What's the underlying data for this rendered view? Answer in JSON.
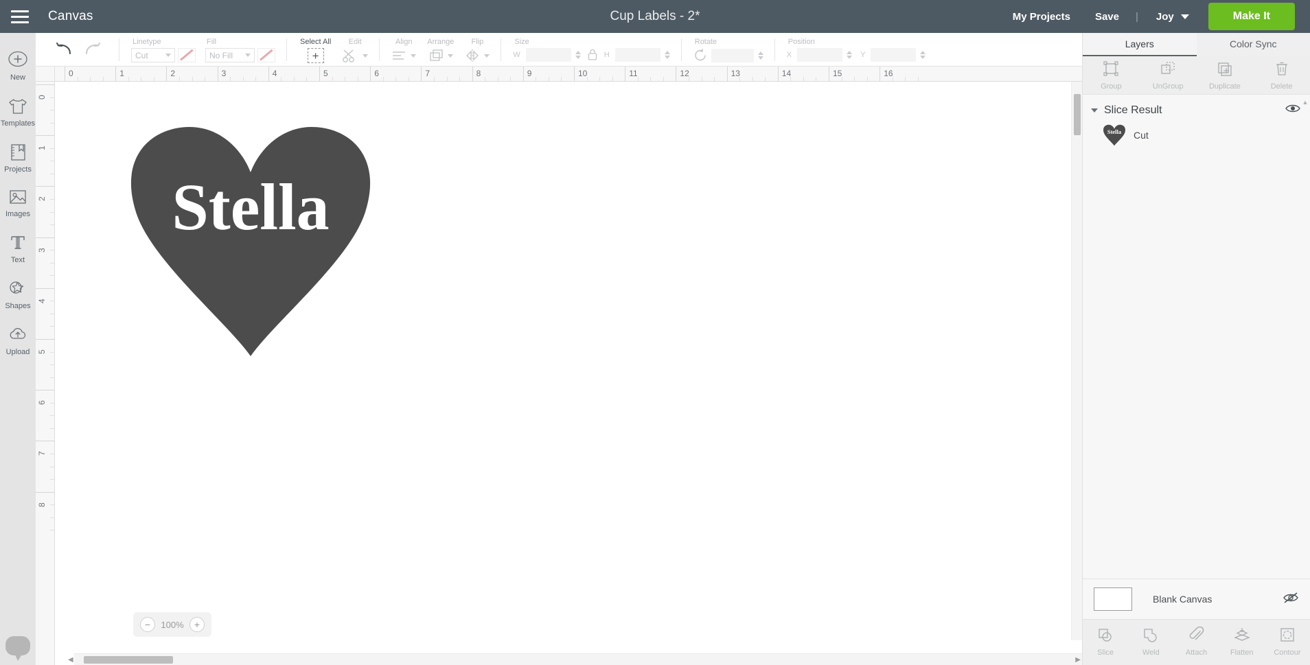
{
  "topbar": {
    "menu_icon": "hamburger-menu-icon",
    "canvas_label": "Canvas",
    "document_title": "Cup Labels - 2*",
    "my_projects": "My Projects",
    "save": "Save",
    "separator": "|",
    "machine": "Joy",
    "make_it": "Make It",
    "make_it_color": "#6cbd20",
    "background_color": "#4e5a63"
  },
  "left_rail": {
    "items": [
      {
        "label": "New",
        "icon": "plus-circle-icon"
      },
      {
        "label": "Templates",
        "icon": "tshirt-icon"
      },
      {
        "label": "Projects",
        "icon": "book-bookmark-icon"
      },
      {
        "label": "Images",
        "icon": "image-icon"
      },
      {
        "label": "Text",
        "icon": "text-t-icon"
      },
      {
        "label": "Shapes",
        "icon": "shapes-icon"
      },
      {
        "label": "Upload",
        "icon": "cloud-upload-icon"
      }
    ],
    "chat_icon": "chat-bubble-icon"
  },
  "toolbar": {
    "undo_icon": "undo-arrow-icon",
    "redo_icon": "redo-arrow-icon",
    "linetype": {
      "label": "Linetype",
      "value": "Cut",
      "swatch_icon": "line-swatch-icon"
    },
    "fill": {
      "label": "Fill",
      "value": "No Fill",
      "swatch_icon": "fill-swatch-icon"
    },
    "select_all": {
      "label": "Select All",
      "icon": "select-all-icon"
    },
    "edit": {
      "label": "Edit",
      "icon": "edit-scissors-icon"
    },
    "align": {
      "label": "Align",
      "icon": "align-icon"
    },
    "arrange": {
      "label": "Arrange",
      "icon": "arrange-icon"
    },
    "flip": {
      "label": "Flip",
      "icon": "flip-icon"
    },
    "size": {
      "label": "Size",
      "w_label": "W",
      "h_label": "H",
      "w_value": "",
      "h_value": "",
      "lock_icon": "lock-icon"
    },
    "rotate": {
      "label": "Rotate",
      "value": "",
      "icon": "rotate-icon"
    },
    "position": {
      "label": "Position",
      "x_label": "X",
      "y_label": "Y",
      "x_value": "",
      "y_value": ""
    }
  },
  "rulers": {
    "horizontal_ticks": [
      "0",
      "1",
      "2",
      "3",
      "4",
      "5",
      "6",
      "7",
      "8",
      "9",
      "10",
      "11",
      "12",
      "13",
      "14",
      "15",
      "16"
    ],
    "vertical_ticks": [
      "0",
      "1",
      "2",
      "3",
      "4",
      "5",
      "6",
      "7",
      "8"
    ],
    "unit": "in"
  },
  "canvas": {
    "zoom_level": "100%",
    "zoom_out_icon": "minus-circle-icon",
    "zoom_in_icon": "plus-circle-icon",
    "artwork": {
      "shape": "heart",
      "shape_color": "#4c4c4c",
      "text": "Stella",
      "text_color": "#ffffff"
    }
  },
  "right_panel": {
    "tabs": [
      {
        "label": "Layers",
        "active": true
      },
      {
        "label": "Color Sync",
        "active": false
      }
    ],
    "top_ops": [
      {
        "label": "Group",
        "icon": "group-icon"
      },
      {
        "label": "UnGroup",
        "icon": "ungroup-icon"
      },
      {
        "label": "Duplicate",
        "icon": "duplicate-icon"
      },
      {
        "label": "Delete",
        "icon": "trash-icon"
      }
    ],
    "layer_group": {
      "name": "Slice Result",
      "visibility_icon": "eye-icon",
      "expand_icon": "caret-down-icon"
    },
    "layers": [
      {
        "name": "Cut",
        "thumb": "heart-stella-thumb",
        "thumb_color": "#4c4c4c"
      }
    ],
    "canvas_layer": {
      "name": "Blank Canvas",
      "visibility_icon": "eye-slash-icon",
      "swatch_color": "#ffffff"
    },
    "bottom_ops": [
      {
        "label": "Slice",
        "icon": "slice-icon"
      },
      {
        "label": "Weld",
        "icon": "weld-icon"
      },
      {
        "label": "Attach",
        "icon": "paperclip-icon"
      },
      {
        "label": "Flatten",
        "icon": "flatten-icon"
      },
      {
        "label": "Contour",
        "icon": "contour-icon"
      }
    ]
  }
}
